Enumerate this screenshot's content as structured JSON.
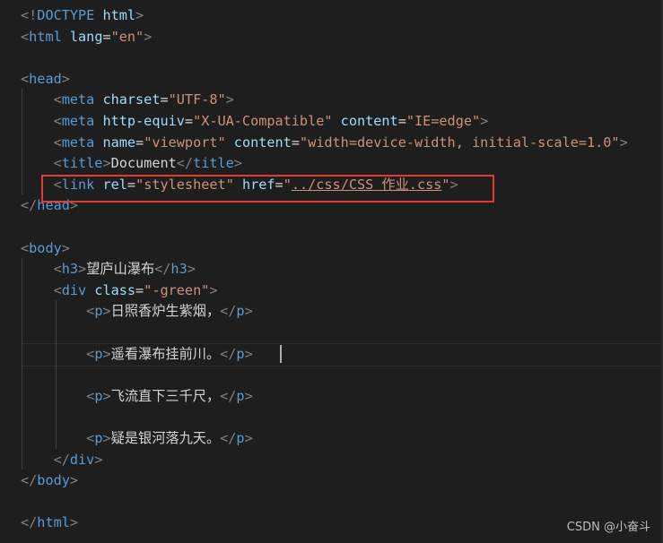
{
  "editor": {
    "language": "html",
    "lines": [
      {
        "segments": [
          {
            "t": "<!",
            "c": "tag"
          },
          {
            "t": "DOCTYPE",
            "c": "name"
          },
          {
            "t": " ",
            "c": "txt"
          },
          {
            "t": "html",
            "c": "attr"
          },
          {
            "t": ">",
            "c": "tag"
          }
        ]
      },
      {
        "segments": [
          {
            "t": "<",
            "c": "tag"
          },
          {
            "t": "html",
            "c": "name"
          },
          {
            "t": " ",
            "c": "txt"
          },
          {
            "t": "lang",
            "c": "attr"
          },
          {
            "t": "=",
            "c": "txt"
          },
          {
            "t": "\"en\"",
            "c": "val"
          },
          {
            "t": ">",
            "c": "tag"
          }
        ]
      },
      {
        "segments": []
      },
      {
        "segments": [
          {
            "t": "<",
            "c": "tag"
          },
          {
            "t": "head",
            "c": "name"
          },
          {
            "t": ">",
            "c": "tag"
          }
        ]
      },
      {
        "segments": [
          {
            "t": "    ",
            "c": "txt"
          },
          {
            "t": "<",
            "c": "tag"
          },
          {
            "t": "meta",
            "c": "name"
          },
          {
            "t": " ",
            "c": "txt"
          },
          {
            "t": "charset",
            "c": "attr"
          },
          {
            "t": "=",
            "c": "txt"
          },
          {
            "t": "\"UTF-8\"",
            "c": "val"
          },
          {
            "t": ">",
            "c": "tag"
          }
        ]
      },
      {
        "segments": [
          {
            "t": "    ",
            "c": "txt"
          },
          {
            "t": "<",
            "c": "tag"
          },
          {
            "t": "meta",
            "c": "name"
          },
          {
            "t": " ",
            "c": "txt"
          },
          {
            "t": "http-equiv",
            "c": "attr"
          },
          {
            "t": "=",
            "c": "txt"
          },
          {
            "t": "\"X-UA-Compatible\"",
            "c": "val"
          },
          {
            "t": " ",
            "c": "txt"
          },
          {
            "t": "content",
            "c": "attr"
          },
          {
            "t": "=",
            "c": "txt"
          },
          {
            "t": "\"IE=edge\"",
            "c": "val"
          },
          {
            "t": ">",
            "c": "tag"
          }
        ]
      },
      {
        "segments": [
          {
            "t": "    ",
            "c": "txt"
          },
          {
            "t": "<",
            "c": "tag"
          },
          {
            "t": "meta",
            "c": "name"
          },
          {
            "t": " ",
            "c": "txt"
          },
          {
            "t": "name",
            "c": "attr"
          },
          {
            "t": "=",
            "c": "txt"
          },
          {
            "t": "\"viewport\"",
            "c": "val"
          },
          {
            "t": " ",
            "c": "txt"
          },
          {
            "t": "content",
            "c": "attr"
          },
          {
            "t": "=",
            "c": "txt"
          },
          {
            "t": "\"width=device-width, initial-scale=1.0\"",
            "c": "val"
          },
          {
            "t": ">",
            "c": "tag"
          }
        ]
      },
      {
        "segments": [
          {
            "t": "    ",
            "c": "txt"
          },
          {
            "t": "<",
            "c": "tag"
          },
          {
            "t": "title",
            "c": "name"
          },
          {
            "t": ">",
            "c": "tag"
          },
          {
            "t": "Document",
            "c": "txt"
          },
          {
            "t": "</",
            "c": "tag"
          },
          {
            "t": "title",
            "c": "name"
          },
          {
            "t": ">",
            "c": "tag"
          }
        ]
      },
      {
        "segments": [
          {
            "t": "    ",
            "c": "txt"
          },
          {
            "t": "<",
            "c": "tag"
          },
          {
            "t": "link",
            "c": "name"
          },
          {
            "t": " ",
            "c": "txt"
          },
          {
            "t": "rel",
            "c": "attr"
          },
          {
            "t": "=",
            "c": "txt"
          },
          {
            "t": "\"stylesheet\"",
            "c": "val"
          },
          {
            "t": " ",
            "c": "txt"
          },
          {
            "t": "href",
            "c": "attr"
          },
          {
            "t": "=",
            "c": "txt"
          },
          {
            "t": "\"",
            "c": "val"
          },
          {
            "t": "../css/CSS 作业.css",
            "c": "val link"
          },
          {
            "t": "\"",
            "c": "val"
          },
          {
            "t": ">",
            "c": "tag"
          }
        ]
      },
      {
        "segments": [
          {
            "t": "</",
            "c": "tag"
          },
          {
            "t": "head",
            "c": "name"
          },
          {
            "t": ">",
            "c": "tag"
          }
        ]
      },
      {
        "segments": []
      },
      {
        "segments": [
          {
            "t": "<",
            "c": "tag"
          },
          {
            "t": "body",
            "c": "name"
          },
          {
            "t": ">",
            "c": "tag"
          }
        ]
      },
      {
        "segments": [
          {
            "t": "    ",
            "c": "txt"
          },
          {
            "t": "<",
            "c": "tag"
          },
          {
            "t": "h3",
            "c": "name"
          },
          {
            "t": ">",
            "c": "tag"
          },
          {
            "t": "望庐山瀑布",
            "c": "txt"
          },
          {
            "t": "</",
            "c": "tag"
          },
          {
            "t": "h3",
            "c": "name"
          },
          {
            "t": ">",
            "c": "tag"
          }
        ]
      },
      {
        "segments": [
          {
            "t": "    ",
            "c": "txt"
          },
          {
            "t": "<",
            "c": "tag"
          },
          {
            "t": "div",
            "c": "name"
          },
          {
            "t": " ",
            "c": "txt"
          },
          {
            "t": "class",
            "c": "attr"
          },
          {
            "t": "=",
            "c": "txt"
          },
          {
            "t": "\"-green\"",
            "c": "val"
          },
          {
            "t": ">",
            "c": "tag"
          }
        ]
      },
      {
        "segments": [
          {
            "t": "        ",
            "c": "txt"
          },
          {
            "t": "<",
            "c": "tag"
          },
          {
            "t": "p",
            "c": "name"
          },
          {
            "t": ">",
            "c": "tag"
          },
          {
            "t": "日照香炉生紫烟，",
            "c": "txt"
          },
          {
            "t": "</",
            "c": "tag"
          },
          {
            "t": "p",
            "c": "name"
          },
          {
            "t": ">",
            "c": "tag"
          }
        ]
      },
      {
        "segments": []
      },
      {
        "segments": [
          {
            "t": "        ",
            "c": "txt"
          },
          {
            "t": "<",
            "c": "tag"
          },
          {
            "t": "p",
            "c": "name"
          },
          {
            "t": ">",
            "c": "tag"
          },
          {
            "t": "遥看瀑布挂前川。",
            "c": "txt"
          },
          {
            "t": "</",
            "c": "tag"
          },
          {
            "t": "p",
            "c": "name"
          },
          {
            "t": ">",
            "c": "tag"
          }
        ]
      },
      {
        "segments": []
      },
      {
        "segments": [
          {
            "t": "        ",
            "c": "txt"
          },
          {
            "t": "<",
            "c": "tag"
          },
          {
            "t": "p",
            "c": "name"
          },
          {
            "t": ">",
            "c": "tag"
          },
          {
            "t": "飞流直下三千尺，",
            "c": "txt"
          },
          {
            "t": "</",
            "c": "tag"
          },
          {
            "t": "p",
            "c": "name"
          },
          {
            "t": ">",
            "c": "tag"
          }
        ]
      },
      {
        "segments": []
      },
      {
        "segments": [
          {
            "t": "        ",
            "c": "txt"
          },
          {
            "t": "<",
            "c": "tag"
          },
          {
            "t": "p",
            "c": "name"
          },
          {
            "t": ">",
            "c": "tag"
          },
          {
            "t": "疑是银河落九天。",
            "c": "txt"
          },
          {
            "t": "</",
            "c": "tag"
          },
          {
            "t": "p",
            "c": "name"
          },
          {
            "t": ">",
            "c": "tag"
          }
        ]
      },
      {
        "segments": [
          {
            "t": "    ",
            "c": "txt"
          },
          {
            "t": "</",
            "c": "tag"
          },
          {
            "t": "div",
            "c": "name"
          },
          {
            "t": ">",
            "c": "tag"
          }
        ]
      },
      {
        "segments": [
          {
            "t": "</",
            "c": "tag"
          },
          {
            "t": "body",
            "c": "name"
          },
          {
            "t": ">",
            "c": "tag"
          }
        ]
      },
      {
        "segments": []
      },
      {
        "segments": [
          {
            "t": "</",
            "c": "tag"
          },
          {
            "t": "html",
            "c": "name"
          },
          {
            "t": ">",
            "c": "tag"
          }
        ]
      }
    ],
    "highlighted_line": 9,
    "current_line": 17
  },
  "colors": {
    "background": "#1e1e1e",
    "tag_bracket": "#808080",
    "tag_name": "#569cd6",
    "attribute": "#9cdcfe",
    "string": "#ce9178",
    "text": "#d4d4d4",
    "annotation_box": "#e53935"
  },
  "watermark": {
    "text": "CSDN @小奋斗"
  }
}
